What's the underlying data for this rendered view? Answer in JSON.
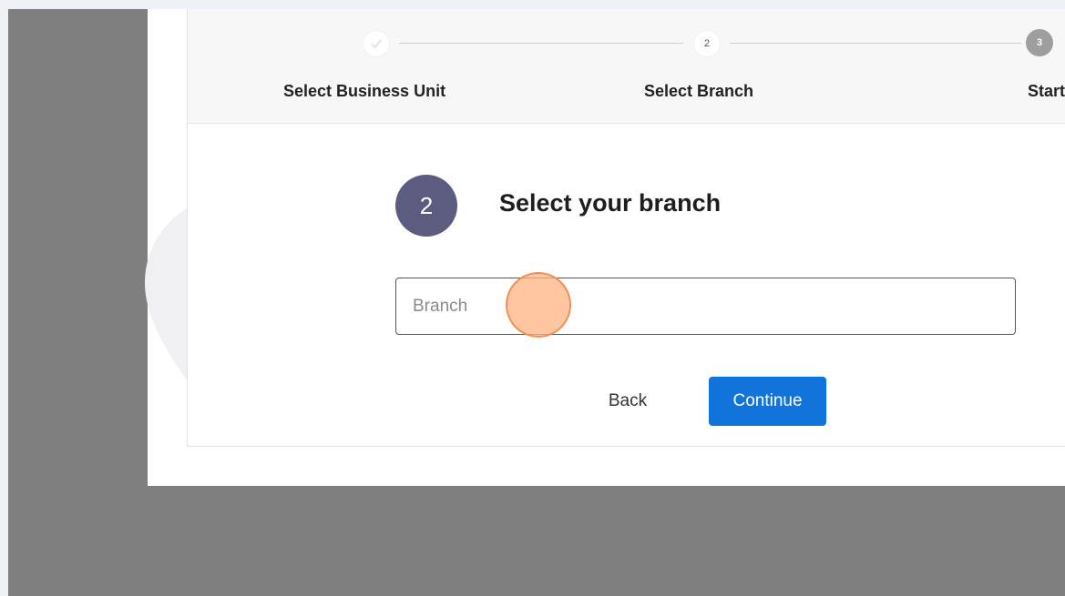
{
  "stepper": {
    "steps": [
      {
        "label": "Select Business Unit",
        "marker": "",
        "state": "completed"
      },
      {
        "label": "Select Branch",
        "marker": "2",
        "state": "current"
      },
      {
        "label": "Start",
        "marker": "3",
        "state": "upcoming"
      }
    ]
  },
  "main": {
    "step_number": "2",
    "heading": "Select your branch",
    "branch_placeholder": "Branch",
    "branch_value": "",
    "back_label": "Back",
    "continue_label": "Continue"
  },
  "icons": {
    "completed_step": "check-icon",
    "background_illustration": "location-pin-icon"
  },
  "colors": {
    "primary_button": "#1273d8",
    "step_badge": "#5b5c7f",
    "upcoming_step": "#9e9e9e",
    "click_highlight": "#fdb482"
  }
}
